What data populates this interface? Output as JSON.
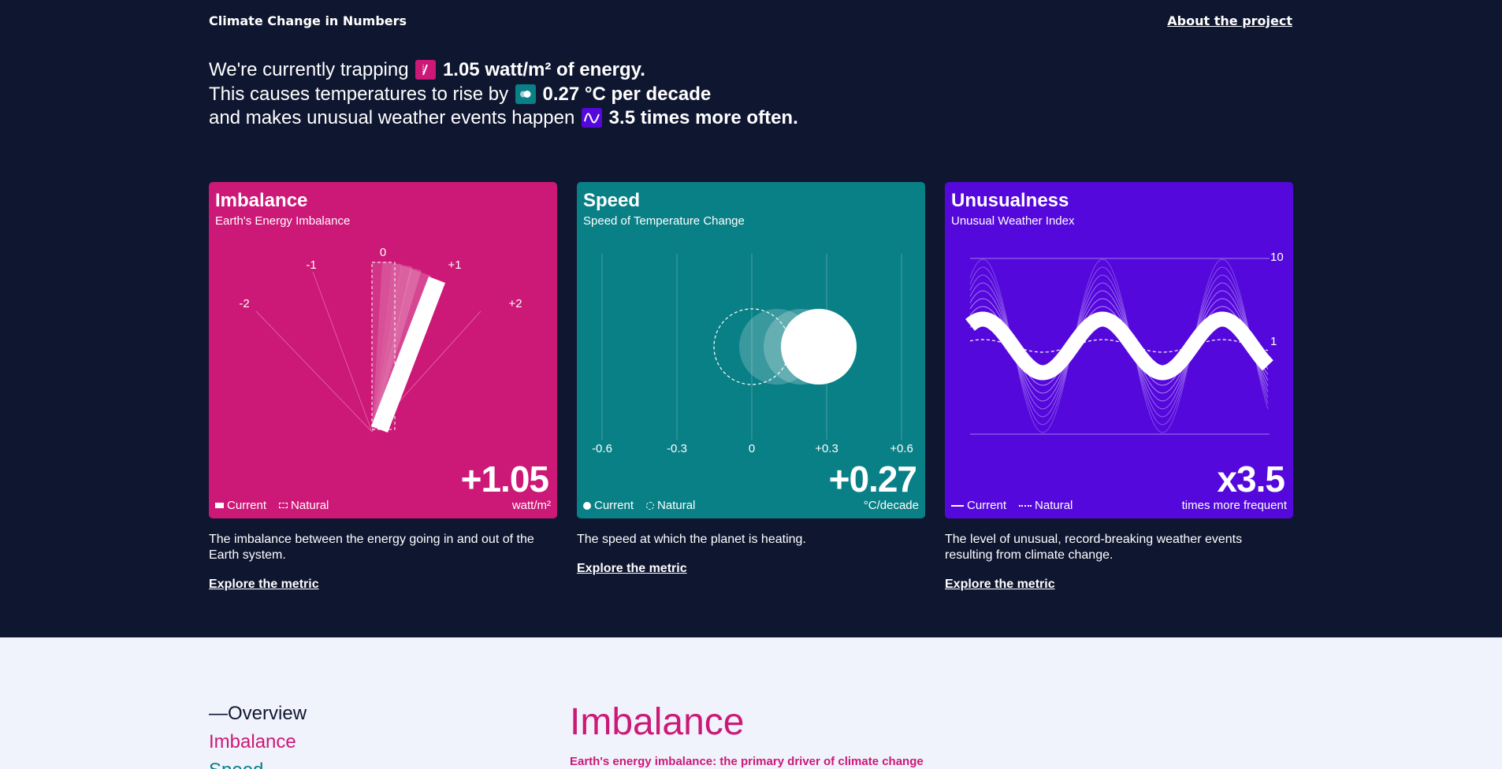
{
  "header": {
    "site_title": "Climate Change in Numbers",
    "about_link": "About the project"
  },
  "intro": {
    "line1_prefix": "We're currently trapping",
    "line1_value": "1.05 watt/m² of energy.",
    "line2_prefix": "This causes temperatures to rise by",
    "line2_value": "0.27 °C per decade",
    "line3_prefix": "and makes unusual weather events happen",
    "line3_value": "3.5 times more often."
  },
  "colors": {
    "background_dark": "#0f1630",
    "imbalance": "#cc1877",
    "speed": "#098086",
    "unusualness": "#5508dc",
    "light_bg": "#f0f3fc"
  },
  "cards": {
    "imbalance": {
      "title": "Imbalance",
      "subtitle": "Earth's Energy Imbalance",
      "value": "+1.05",
      "unit": "watt/m²",
      "legend_current": "Current",
      "legend_natural": "Natural",
      "description": "The imbalance between the energy going in and out of the Earth system.",
      "link": "Explore the metric",
      "scale_labels": [
        "-2",
        "-1",
        "0",
        "+1",
        "+2"
      ]
    },
    "speed": {
      "title": "Speed",
      "subtitle": "Speed of Temperature Change",
      "value": "+0.27",
      "unit": "°C/decade",
      "legend_current": "Current",
      "legend_natural": "Natural",
      "description": "The speed at which the planet is heating.",
      "link": "Explore the metric",
      "scale_labels": [
        "-0.6",
        "-0.3",
        "0",
        "+0.3",
        "+0.6"
      ]
    },
    "unusualness": {
      "title": "Unusualness",
      "subtitle": "Unusual Weather Index",
      "value": "x3.5",
      "unit": "times more frequent",
      "legend_current": "Current",
      "legend_natural": "Natural",
      "description": "The level of unusual, record-breaking weather events resulting from climate change.",
      "link": "Explore the metric",
      "scale_labels": [
        "10",
        "1"
      ]
    }
  },
  "nav": {
    "overview": "—Overview",
    "imbalance": "Imbalance",
    "speed": "Speed"
  },
  "section": {
    "title": "Imbalance",
    "subtitle": "Earth's energy imbalance: the primary driver of climate change"
  },
  "icons": {
    "imbalance_badge": "slash-bar-icon",
    "speed_badge": "toggle-dots-icon",
    "unusualness_badge": "wave-icon"
  }
}
